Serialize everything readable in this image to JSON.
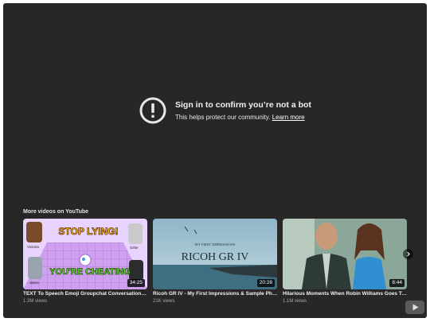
{
  "notice": {
    "title": "Sign in to confirm you’re not a bot",
    "subtitle": "This helps protect our community.",
    "link": "Learn more",
    "icon": "alert-circle-icon"
  },
  "more_videos": {
    "label": "More videos on YouTube",
    "videos": [
      {
        "title": "TEXT To Speech Emoji Groupchat Conversations | ...",
        "views": "1.3M views",
        "duration": "34:25",
        "thumb_text_top": "STOP LYING!",
        "thumb_text_bottom": "YOU'RE CHEATING",
        "thumb_names": [
          "Victoria",
          "Girlie",
          "Jason"
        ]
      },
      {
        "title": "Ricoh GR IV - My First Impressions & Sample Phot...",
        "views": "21K views",
        "duration": "20:28",
        "thumb_small": "MY FIRST IMPRESSIONS",
        "thumb_big": "RICOH GR IV"
      },
      {
        "title": "Hilarious Moments When Robin Williams Goes Tot...",
        "views": "1.1M views",
        "duration": "8:44"
      }
    ]
  },
  "colors": {
    "player_bg": "#272727",
    "accent": "#ff0000"
  }
}
